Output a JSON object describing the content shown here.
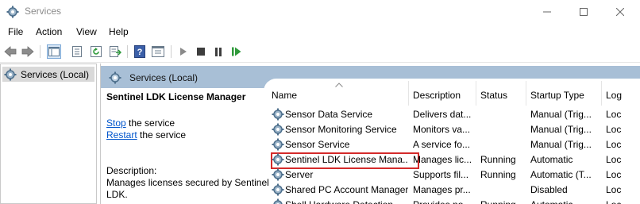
{
  "window": {
    "title": "Services",
    "icon": "gear-icon"
  },
  "menu": [
    "File",
    "Action",
    "View",
    "Help"
  ],
  "tree": {
    "selected_label": "Services (Local)"
  },
  "main": {
    "header_title": "Services (Local)",
    "description": {
      "service_name": "Sentinel LDK License Manager",
      "stop_link": "Stop",
      "stop_rest": " the service",
      "restart_link": "Restart",
      "restart_rest": " the service",
      "label": "Description:",
      "text_line1": "Manages licenses secured by Sentinel",
      "text_line2": "LDK."
    },
    "columns": [
      "Name",
      "Description",
      "Status",
      "Startup Type",
      "Log"
    ],
    "rows": [
      {
        "name": "Sensor Data Service",
        "description": "Delivers dat...",
        "status": "",
        "startup": "Manual (Trig...",
        "logon": "Loc"
      },
      {
        "name": "Sensor Monitoring Service",
        "description": "Monitors va...",
        "status": "",
        "startup": "Manual (Trig...",
        "logon": "Loc"
      },
      {
        "name": "Sensor Service",
        "description": "A service fo...",
        "status": "",
        "startup": "Manual (Trig...",
        "logon": "Loc"
      },
      {
        "name": "Sentinel LDK License Mana...",
        "description": "Manages lic...",
        "status": "Running",
        "startup": "Automatic",
        "logon": "Loc"
      },
      {
        "name": "Server",
        "description": "Supports fil...",
        "status": "Running",
        "startup": "Automatic (T...",
        "logon": "Loc"
      },
      {
        "name": "Shared PC Account Manager",
        "description": "Manages pr...",
        "status": "",
        "startup": "Disabled",
        "logon": "Loc"
      },
      {
        "name": "Shell Hardware Detection",
        "description": "Provides no...",
        "status": "Running",
        "startup": "Automatic",
        "logon": "Loc"
      }
    ],
    "highlighted_row_index": 3
  },
  "colors": {
    "header_band": "#a8bfd6",
    "highlight_outline": "#d42a2a",
    "link": "#0055cc"
  }
}
